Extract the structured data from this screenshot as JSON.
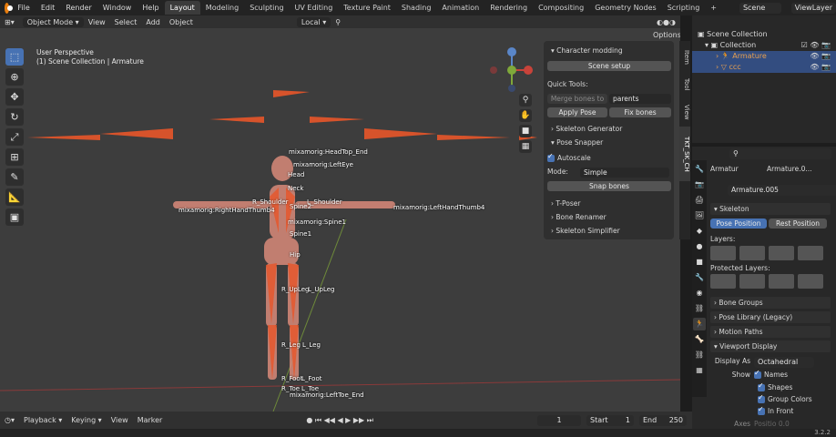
{
  "topbar": {
    "menus": [
      "File",
      "Edit",
      "Render",
      "Window",
      "Help"
    ],
    "workspaces": [
      "Layout",
      "Modeling",
      "Sculpting",
      "UV Editing",
      "Texture Paint",
      "Shading",
      "Animation",
      "Rendering",
      "Compositing",
      "Geometry Nodes",
      "Scripting"
    ],
    "active_workspace": "Layout",
    "add_tab": "+",
    "scene": "Scene",
    "view_layer": "ViewLayer"
  },
  "viewport_header": {
    "mode": "Object Mode",
    "menus": [
      "View",
      "Select",
      "Add",
      "Object"
    ],
    "orientation": "Local",
    "options": "Options"
  },
  "viewport": {
    "perspective": "User Perspective",
    "collection": "(1) Scene Collection | Armature",
    "gizmo_axes": [
      "X",
      "Y",
      "Z"
    ],
    "bone_labels": [
      "mixamorig:HeadTop_End",
      "mixamorig:LeftEye",
      "Head",
      "Neck",
      "R_Shoulder",
      "L_Shoulder",
      "mixamorig:RightHandThumb4",
      "mixamorig:LeftHandThumb4",
      "Spine2",
      "mixamorig:Spine1",
      "Spine1",
      "Hip",
      "R_UpLeg",
      "L_UpLeg",
      "R_Leg",
      "L_Leg",
      "R_Foot",
      "L_Foot",
      "R_Toe",
      "L_Toe",
      "mixamorig:LeftToe_End"
    ]
  },
  "npanel": {
    "title": "Character modding",
    "scene_setup": "Scene setup",
    "quick_tools": "Quick Tools:",
    "merge_bones": "Merge bones to",
    "merge_target": "parents",
    "apply_pose": "Apply Pose",
    "fix_bones": "Fix bones",
    "sections_a": [
      "Skeleton Generator",
      "Pose Snapper"
    ],
    "autoscale": "Autoscale",
    "mode_label": "Mode:",
    "mode_value": "Simple",
    "snap_bones": "Snap bones",
    "sections_b": [
      "T-Poser",
      "Bone Renamer",
      "Skeleton Simplifier"
    ],
    "tabs": [
      "Item",
      "Tool",
      "View",
      "TKT_SK_CH"
    ]
  },
  "outliner": {
    "root": "Scene Collection",
    "collection": "Collection",
    "armature": "Armature",
    "mesh": "ccc"
  },
  "properties": {
    "search_placeholder": "",
    "breadcrumb_object": "Armatur",
    "breadcrumb_data": "Armature.0...",
    "data_name": "Armature.005",
    "skeleton": "Skeleton",
    "pose_position": "Pose Position",
    "rest_position": "Rest Position",
    "layers": "Layers:",
    "protected_layers": "Protected Layers:",
    "sections": [
      "Bone Groups",
      "Pose Library (Legacy)",
      "Motion Paths"
    ],
    "viewport_display": "Viewport Display",
    "display_as_label": "Display As",
    "display_as_value": "Octahedral",
    "show_label": "Show",
    "show_options": [
      "Names",
      "Shapes",
      "Group Colors",
      "In Front"
    ],
    "axes_label": "Axes",
    "axes_position": "Positio 0.0"
  },
  "timeline": {
    "menus": [
      "Playback",
      "Keying",
      "View",
      "Marker"
    ],
    "current_frame": "1",
    "start_label": "Start",
    "start": "1",
    "end_label": "End",
    "end": "250"
  },
  "status": {
    "version": "3.2.2"
  },
  "colors": {
    "accent_blue": "#4772b3",
    "bone_orange": "#e8562a",
    "selection": "#334d80"
  }
}
